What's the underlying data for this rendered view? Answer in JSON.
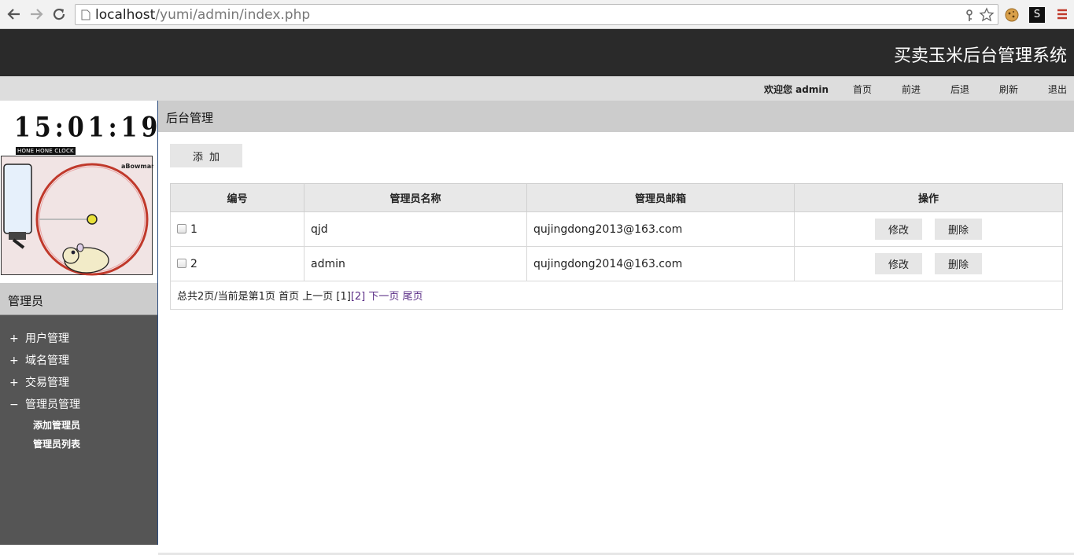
{
  "browser": {
    "url_host": "localhost",
    "url_path": "/yumi/admin/index.php"
  },
  "header": {
    "title": "买卖玉米后台管理系统"
  },
  "top_nav": {
    "welcome": "欢迎您 admin",
    "links": [
      "首页",
      "前进",
      "后退",
      "刷新",
      "退出"
    ]
  },
  "sidebar": {
    "clock_time": "15:01:19",
    "clock_caption": "HONE HONE CLOCK",
    "widget_tag": "aBowman",
    "title": "管理员",
    "menu": [
      {
        "marker": "+",
        "label": "用户管理"
      },
      {
        "marker": "+",
        "label": "域名管理"
      },
      {
        "marker": "+",
        "label": "交易管理"
      },
      {
        "marker": "−",
        "label": "管理员管理"
      }
    ],
    "submenu": [
      "添加管理员",
      "管理员列表"
    ]
  },
  "main": {
    "title": "后台管理",
    "add_button": "添加",
    "table": {
      "headers": [
        "编号",
        "管理员名称",
        "管理员邮箱",
        "操作"
      ],
      "rows": [
        {
          "id": "1",
          "name": "qjd",
          "email": "qujingdong2013@163.com"
        },
        {
          "id": "2",
          "name": "admin",
          "email": "qujingdong2014@163.com"
        }
      ],
      "edit_label": "修改",
      "delete_label": "删除"
    },
    "pager": {
      "summary": "总共2页/当前是第1页",
      "first": "首页",
      "prev": "上一页",
      "current": "[1]",
      "page2": "[2]",
      "next": "下一页",
      "last": "尾页"
    }
  }
}
